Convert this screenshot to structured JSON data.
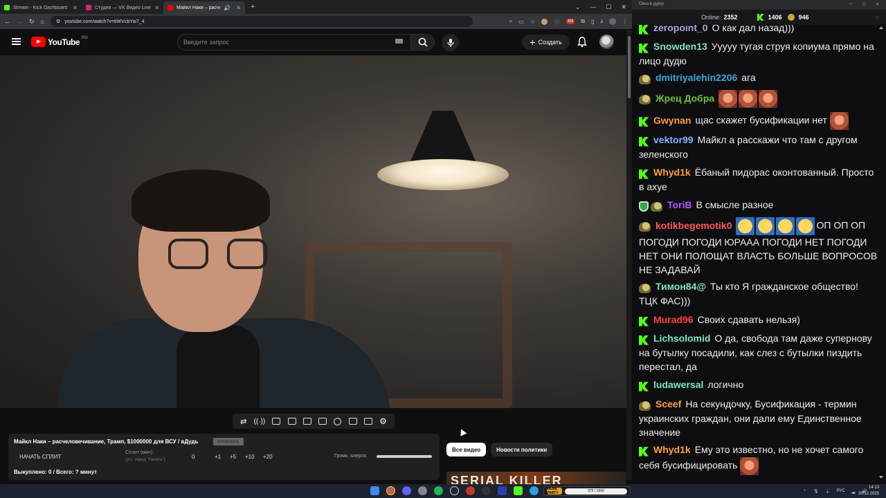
{
  "browser": {
    "tabs": [
      {
        "title": "Stream - Kick Dashboard",
        "favicon_color": "#53fc18"
      },
      {
        "title": "Студия — VK Видео Live",
        "favicon_color": "#e0245e"
      },
      {
        "title": "Майкл Наки – расчелове...",
        "favicon_color": "#ff0000",
        "active": true
      }
    ],
    "url": "youtube.com/watch?v=tiWVcbYw7_4",
    "extension_badge": "455"
  },
  "youtube": {
    "logo_text": "YouTube",
    "logo_region": "RU",
    "search_placeholder": "Введите запрос",
    "create_label": "Создать"
  },
  "overlay_panel": {
    "title": "Майкл Наки – расчеловечивание, Трамп, $1000000 для ВСУ / вДудь",
    "copy_label": "копировать",
    "start_split_label": "НАЧАТЬ СПЛИТ",
    "split_label": "Сплит (мин):",
    "split_sub": "(уст. перед \"Начать\")",
    "split_value": "0",
    "increments": [
      "+1",
      "+5",
      "+10",
      "+20"
    ],
    "volume_label": "Громк. алерта:",
    "bought_text": "Выкуплено: 0 / Всего: ? минут"
  },
  "filters": {
    "all_videos": "Все видео",
    "politics_news": "Новости политики"
  },
  "thumbnail_text": "SERIAL KILLER",
  "chat_window": {
    "title": "Окно в дурку",
    "online_label": "Online:",
    "online_value": "2352",
    "kick_count": "1406",
    "coin_count": "946"
  },
  "chat": [
    {
      "user": "zeropoint_0",
      "color": "#b9a3e3",
      "badge": "kick",
      "text": "О как дал назад)))"
    },
    {
      "user": "Snowden13",
      "color": "#7ee6c8",
      "badge": "kick",
      "text": "Ууууу тугая струя копиума прямо на лицо дудю"
    },
    {
      "user": "dmitriyalehin2206",
      "color": "#3ba7d6",
      "badge": "avatar",
      "text": "ага"
    },
    {
      "user": "Жрец Добра",
      "color": "#6dbf3a",
      "badge": "avatar",
      "text": "",
      "emotes": [
        "face",
        "face",
        "face"
      ]
    },
    {
      "user": "Gwynan",
      "color": "#ff9f3a",
      "badge": "kick",
      "text": "щас скажет бусификации нет",
      "emotes": [
        "face"
      ]
    },
    {
      "user": "vektor99",
      "color": "#7fb4ff",
      "badge": "kick",
      "text": "Майкл а расскажи что там с другом зеленского"
    },
    {
      "user": "Whyd1k",
      "color": "#ff9f3a",
      "badge": "kick",
      "text": "Ёбаный пидорас оконтованный. Просто в ахуе"
    },
    {
      "user": "ToriB",
      "color": "#b05cff",
      "badge": "shield-avatar",
      "text": "В смысле разное"
    },
    {
      "user": "kotikbegemotik0",
      "color": "#ff5a5a",
      "badge": "avatar",
      "text": "ОП ОП ОП ПОГОДИ ПОГОДИ ЮРААА ПОГОДИ НЕТ ПОГОДИ НЕТ ОНИ ПОЛОЩАТ ВЛАСТЬ БОЛЬШЕ ВОПРОСОВ НЕ ЗАДАВАЙ",
      "emotes": [
        "laugh",
        "laugh",
        "laugh",
        "laugh"
      ]
    },
    {
      "user": "Тимон84@",
      "color": "#7ee6c8",
      "badge": "avatar",
      "text": "Ты кто Я гражданское общество! ТЦК ФАС)))"
    },
    {
      "user": "Murad96",
      "color": "#ff4040",
      "badge": "kick",
      "text": "Своих сдавать нельзя)"
    },
    {
      "user": "Lichsolomid",
      "color": "#7ee6c8",
      "badge": "kick",
      "text": "О да, свобода там даже супернову на бутылку посадили, как слез с бутылки пиздить перестал, да"
    },
    {
      "user": "ludawersal",
      "color": "#7ee6c8",
      "badge": "kick",
      "text": "логично"
    },
    {
      "user": "Sceef",
      "color": "#ff9f3a",
      "badge": "avatar",
      "text": "На секундочку, Бусификация - термин украинских граждан, они дали ему Единственное значение"
    },
    {
      "user": "Whyd1k",
      "color": "#ff9f3a",
      "badge": "kick",
      "text": "Ему это известно, но не хочет самого себя бусифицировать",
      "emotes": [
        "face"
      ]
    }
  ],
  "taskbar": {
    "widget_label": "MEME PARTY",
    "widget_value": "375 / 1500",
    "lang": "РУС",
    "time": "14:13",
    "date": "20.12.2025"
  }
}
